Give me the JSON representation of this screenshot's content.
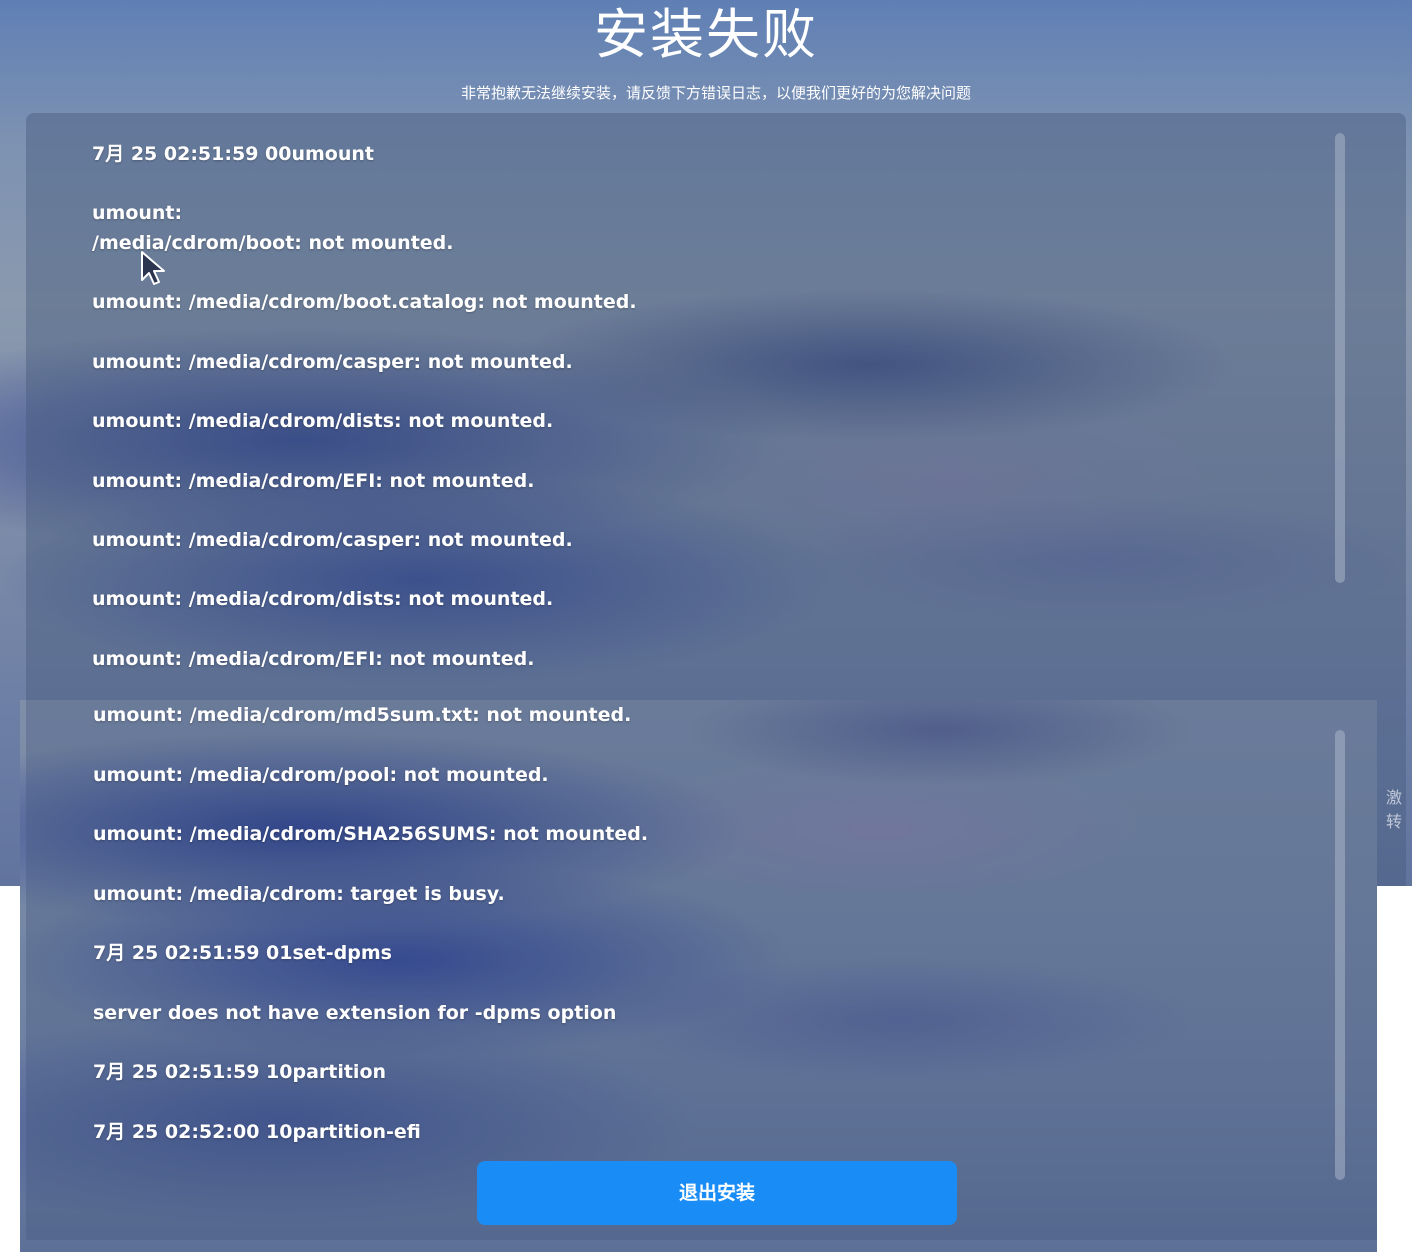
{
  "header": {
    "title": "安装失败",
    "subtitle": "非常抱歉无法继续安装，请反馈下方错误日志，以便我们更好的为您解决问题"
  },
  "log_top": [
    "7月 25 02:51:59 00umount",
    "umount:",
    "/media/cdrom/boot: not mounted.",
    "umount: /media/cdrom/boot.catalog: not mounted.",
    "umount: /media/cdrom/casper: not mounted.",
    "umount: /media/cdrom/dists: not mounted.",
    "umount: /media/cdrom/EFI: not mounted.",
    "umount: /media/cdrom/casper: not mounted.",
    "umount: /media/cdrom/dists: not mounted.",
    "umount: /media/cdrom/EFI: not mounted."
  ],
  "log_bottom": [
    "umount: /media/cdrom/md5sum.txt: not mounted.",
    "umount: /media/cdrom/pool: not mounted.",
    "umount: /media/cdrom/SHA256SUMS: not mounted.",
    "umount: /media/cdrom: target is busy.",
    "7月 25 02:51:59 01set-dpms",
    "server does not have extension for -dpms option",
    "7月 25 02:51:59 10partition",
    "7月 25 02:52:00 10partition-efi"
  ],
  "actions": {
    "exit_label": "退出安装"
  },
  "watermark": {
    "line1": "激",
    "line2": "转"
  },
  "colors": {
    "button": "#1a8cf5",
    "text": "#ffffff"
  },
  "icons": {
    "cursor": "arrow-pointer-icon"
  }
}
